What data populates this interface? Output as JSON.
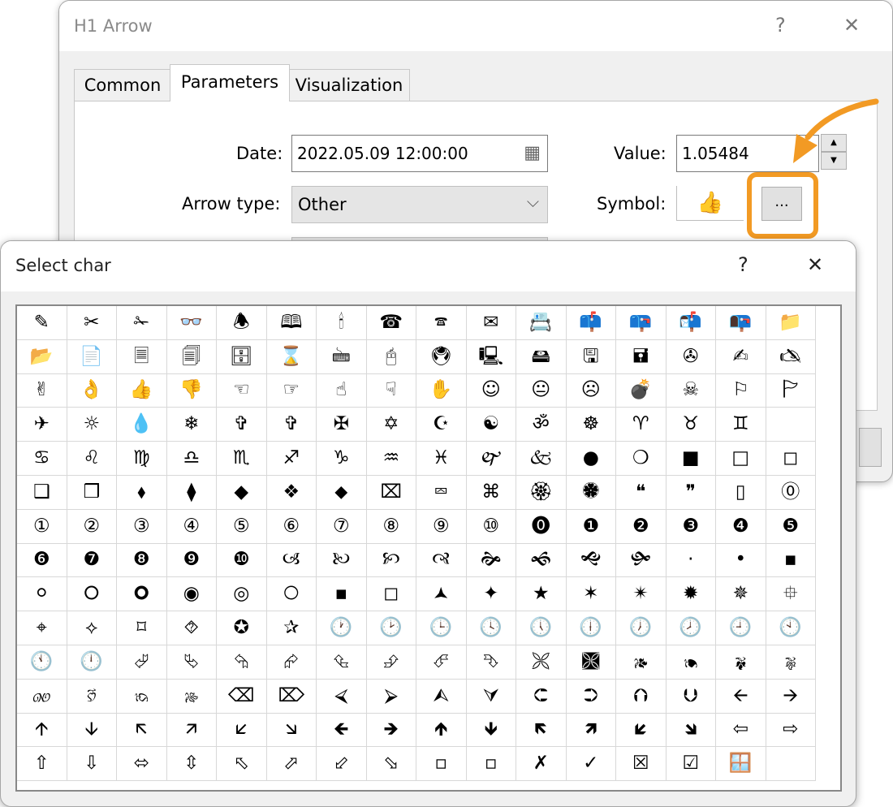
{
  "back_dialog": {
    "title": "H1 Arrow",
    "help_label": "?",
    "close_label": "✕",
    "tabs": [
      {
        "label": "Common",
        "active": false
      },
      {
        "label": "Parameters",
        "active": true
      },
      {
        "label": "Visualization",
        "active": false
      }
    ],
    "date_label": "Date:",
    "date_value": "2022.05.09 12:00:00",
    "arrow_type_label": "Arrow type:",
    "arrow_type_value": "Other",
    "value_label": "Value:",
    "value_value": "1.05484",
    "symbol_label": "Symbol:",
    "symbol_glyph": "👍",
    "symbol_button_label": "...",
    "spin_up": "▲",
    "spin_down": "▼",
    "dropdown_chevron": "⌵",
    "calendar_icon_glyph": "▦",
    "highlight_color": "#f29a24"
  },
  "front_dialog": {
    "title": "Select char",
    "help_label": "?",
    "close_label": "✕",
    "chars": [
      "✎",
      "✂",
      "✁",
      "👓",
      "🕭",
      "🕮",
      "🕯",
      "☎",
      "🕿",
      "✉",
      "📇",
      "📫",
      "📪",
      "📬",
      "📭",
      "📁",
      "📂",
      "📄",
      "🗏",
      "🗐",
      "🗄",
      "⌛",
      "🖮",
      "🖰",
      "🖲",
      "🖳",
      "🖴",
      "🖫",
      "🖬",
      "✇",
      "✍",
      "🖎",
      "✌",
      "👌",
      "👍",
      "👎",
      "☜",
      "☞",
      "☝",
      "☟",
      "✋",
      "☺",
      "😐",
      "☹",
      "💣",
      "☠",
      "⚐",
      "🏱",
      "✈",
      "☼",
      "💧",
      "❄",
      "✞",
      "✞",
      "✠",
      "✡",
      "☪",
      "☯",
      "ॐ",
      "☸",
      "♈",
      "♉",
      "♊",
      "",
      "♋",
      "♌",
      "♍",
      "♎",
      "♏",
      "♐",
      "♑",
      "♒",
      "♓",
      "🙰",
      "🙵",
      "●",
      "❍",
      "■",
      "□",
      "◻",
      "❑",
      "❒",
      "⬧",
      "⧫",
      "◆",
      "❖",
      "⬥",
      "⌧",
      "⮹",
      "⌘",
      "🏵",
      "🏶",
      "❝",
      "❞",
      "▯",
      "⓪",
      "①",
      "②",
      "③",
      "④",
      "⑤",
      "⑥",
      "⑦",
      "⑧",
      "⑨",
      "⑩",
      "⓿",
      "❶",
      "❷",
      "❸",
      "❹",
      "❺",
      "❻",
      "❼",
      "❽",
      "❾",
      "❿",
      "🙢",
      "🙠",
      "🙡",
      "🙣",
      "🙞",
      "🙜",
      "🙝",
      "🙟",
      "·",
      "•",
      "▪",
      "⚪",
      "🞆",
      "🞈",
      "◉",
      "◎",
      "🞅",
      "▪",
      "◻",
      "🟂",
      "✦",
      "★",
      "✶",
      "✴",
      "✹",
      "✵",
      "⯐",
      "⌖",
      "⟡",
      "⌑",
      "⯑",
      "✪",
      "✰",
      "🕐",
      "🕑",
      "🕒",
      "🕓",
      "🕔",
      "🕕",
      "🕖",
      "🕗",
      "🕘",
      "🕙",
      "🕚",
      "🕛",
      "⮰",
      "⮱",
      "⮲",
      "⮳",
      "⮴",
      "⮵",
      "⮶",
      "⮷",
      "🙪",
      "🙫",
      "🙕",
      "🙔",
      "🙗",
      "🙖",
      "🙐",
      "🙑",
      "🙒",
      "🙓",
      "⌫",
      "⌦",
      "⮘",
      "⮚",
      "⮙",
      "⮛",
      "⮈",
      "⮊",
      "⮉",
      "⮋",
      "🡨",
      "🡪",
      "🡩",
      "🡫",
      "🡬",
      "🡭",
      "🡯",
      "🡮",
      "🡸",
      "🡺",
      "🡹",
      "🡻",
      "🡼",
      "🡽",
      "🡿",
      "🡾",
      "⇦",
      "⇨",
      "⇧",
      "⇩",
      "⬄",
      "⇳",
      "⬁",
      "⬀",
      "⬃",
      "⬂",
      "▫",
      "▫",
      "✗",
      "✓",
      "☒",
      "☑",
      "🪟",
      ""
    ]
  }
}
